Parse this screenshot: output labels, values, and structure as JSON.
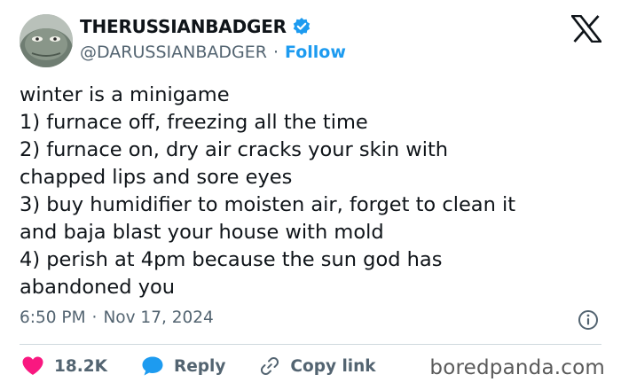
{
  "author": {
    "display_name": "THERUSSIANBADGER",
    "handle": "@DARUSSIANBADGER",
    "separator": "·",
    "follow_label": "Follow"
  },
  "tweet": {
    "lines": [
      "winter is a minigame",
      "1) furnace off, freezing all the time",
      "2) furnace on, dry air cracks your skin with",
      "chapped lips and sore eyes",
      "3) buy humidifier to moisten air, forget to clean it",
      "and baja blast your house with mold",
      "4) perish at 4pm because the sun god has",
      "abandoned you"
    ],
    "time": "6:50 PM",
    "separator": "·",
    "date": "Nov 17, 2024"
  },
  "actions": {
    "likes": "18.2K",
    "reply_label": "Reply",
    "copy_link_label": "Copy link"
  },
  "watermark": "boredpanda.com",
  "icons": {
    "verified": "verified-badge-icon",
    "logo": "x-logo-icon",
    "info": "info-icon",
    "like": "heart-icon",
    "reply": "speech-bubble-icon",
    "copy": "link-icon"
  },
  "colors": {
    "accent": "#1d9bf0",
    "like": "#f91880",
    "text": "#0f1419",
    "muted": "#536471"
  }
}
